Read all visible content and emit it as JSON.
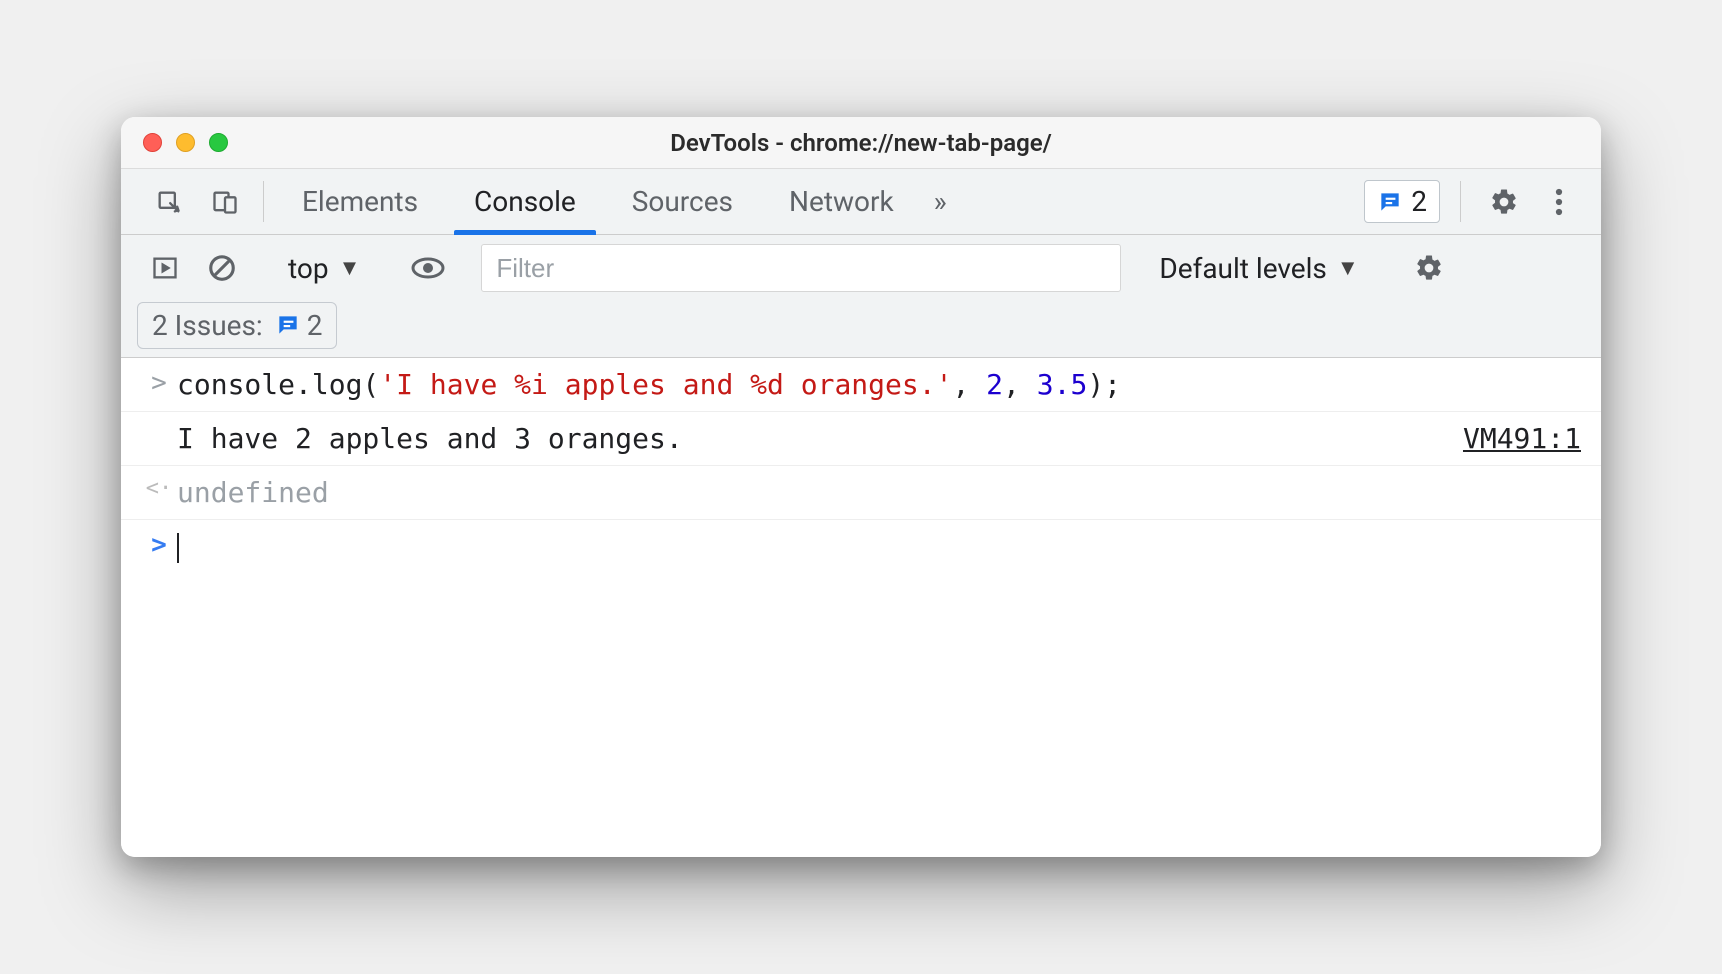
{
  "window": {
    "title": "DevTools - chrome://new-tab-page/"
  },
  "tabs": {
    "elements": "Elements",
    "console": "Console",
    "sources": "Sources",
    "network": "Network",
    "more_glyph": "»"
  },
  "issues_badge": {
    "count": "2"
  },
  "toolbar": {
    "context": "top",
    "filter_placeholder": "Filter",
    "levels": "Default levels"
  },
  "issues_row": {
    "label": "2 Issues:",
    "count": "2"
  },
  "console": {
    "input": {
      "pre": "console.log(",
      "str": "'I have %i apples and %d oranges.'",
      "mid1": ", ",
      "num1": "2",
      "mid2": ", ",
      "num2": "3.5",
      "post": ");"
    },
    "output": "I have 2 apples and 3 oranges.",
    "source": "VM491:1",
    "return": "undefined",
    "prompt_gutter": ">",
    "input_gutter": ">",
    "output_gutter": "",
    "return_gutter": "<·"
  }
}
